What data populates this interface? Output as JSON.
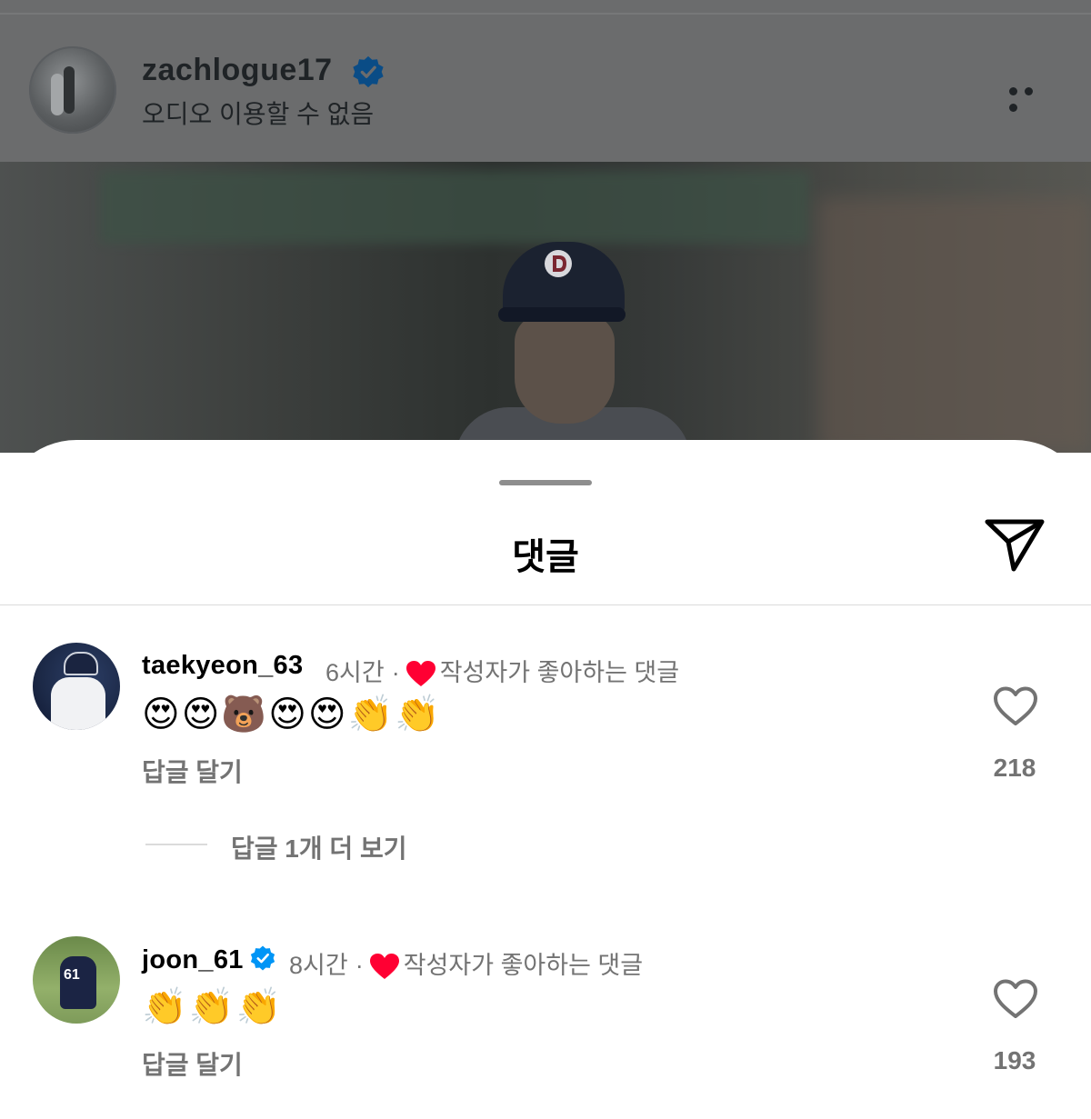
{
  "post_header": {
    "username": "zachlogue17",
    "subtitle": "오디오 이용할 수 없음",
    "more_icon": "more-horizontal-icon"
  },
  "comments_sheet": {
    "title": "댓글",
    "share_icon": "paper-plane-icon"
  },
  "comments": [
    {
      "username": "taekyeon_63",
      "verified": false,
      "time": "6시간",
      "separator": "·",
      "liked_by_author": "작성자가 좋아하는 댓글",
      "text": "😍😍🐻😍😍👏👏",
      "reply_label": "답글 달기",
      "like_count": "218",
      "more_replies": "답글 1개 더 보기"
    },
    {
      "username": "joon_61",
      "verified": true,
      "time": "8시간",
      "separator": "·",
      "liked_by_author": "작성자가 좋아하는 댓글",
      "text": "👏👏👏",
      "reply_label": "답글 달기",
      "like_count": "193"
    }
  ],
  "colors": {
    "verified_blue": "#0095f6",
    "liked_heart": "#ff0033",
    "secondary_text": "#737373"
  }
}
